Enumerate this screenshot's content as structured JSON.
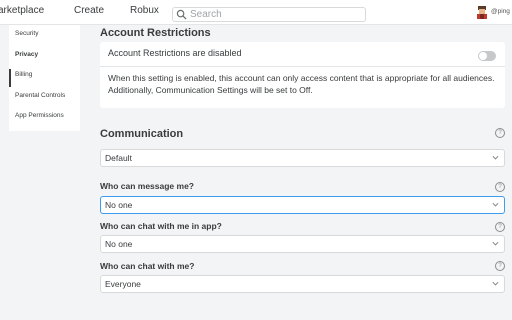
{
  "topnav": {
    "marketplace": "arketplace",
    "create": "Create",
    "robux": "Robux",
    "search_placeholder": "Search",
    "username": "@ping"
  },
  "sidebar": {
    "items": [
      {
        "label": "Security"
      },
      {
        "label": "Privacy"
      },
      {
        "label": "Billing"
      },
      {
        "label": "Parental Controls"
      },
      {
        "label": "App Permissions"
      }
    ],
    "active": "Privacy"
  },
  "account_restrictions": {
    "title": "Account Restrictions",
    "status_label": "Account Restrictions are disabled",
    "enabled": false,
    "description": "When this setting is enabled, this account can only access content that is appropriate for all audiences. Additionally, Communication Settings will be set to Off."
  },
  "communication": {
    "title": "Communication",
    "preset": "Default",
    "questions": [
      {
        "label": "Who can message me?",
        "value": "No one"
      },
      {
        "label": "Who can chat with me in app?",
        "value": "No one"
      },
      {
        "label": "Who can chat with me?",
        "value": "Everyone"
      }
    ]
  },
  "colors": {
    "focus_border": "#3d9bf0",
    "background": "#f2f4f5",
    "toggle_off": "#c6c8ca"
  }
}
